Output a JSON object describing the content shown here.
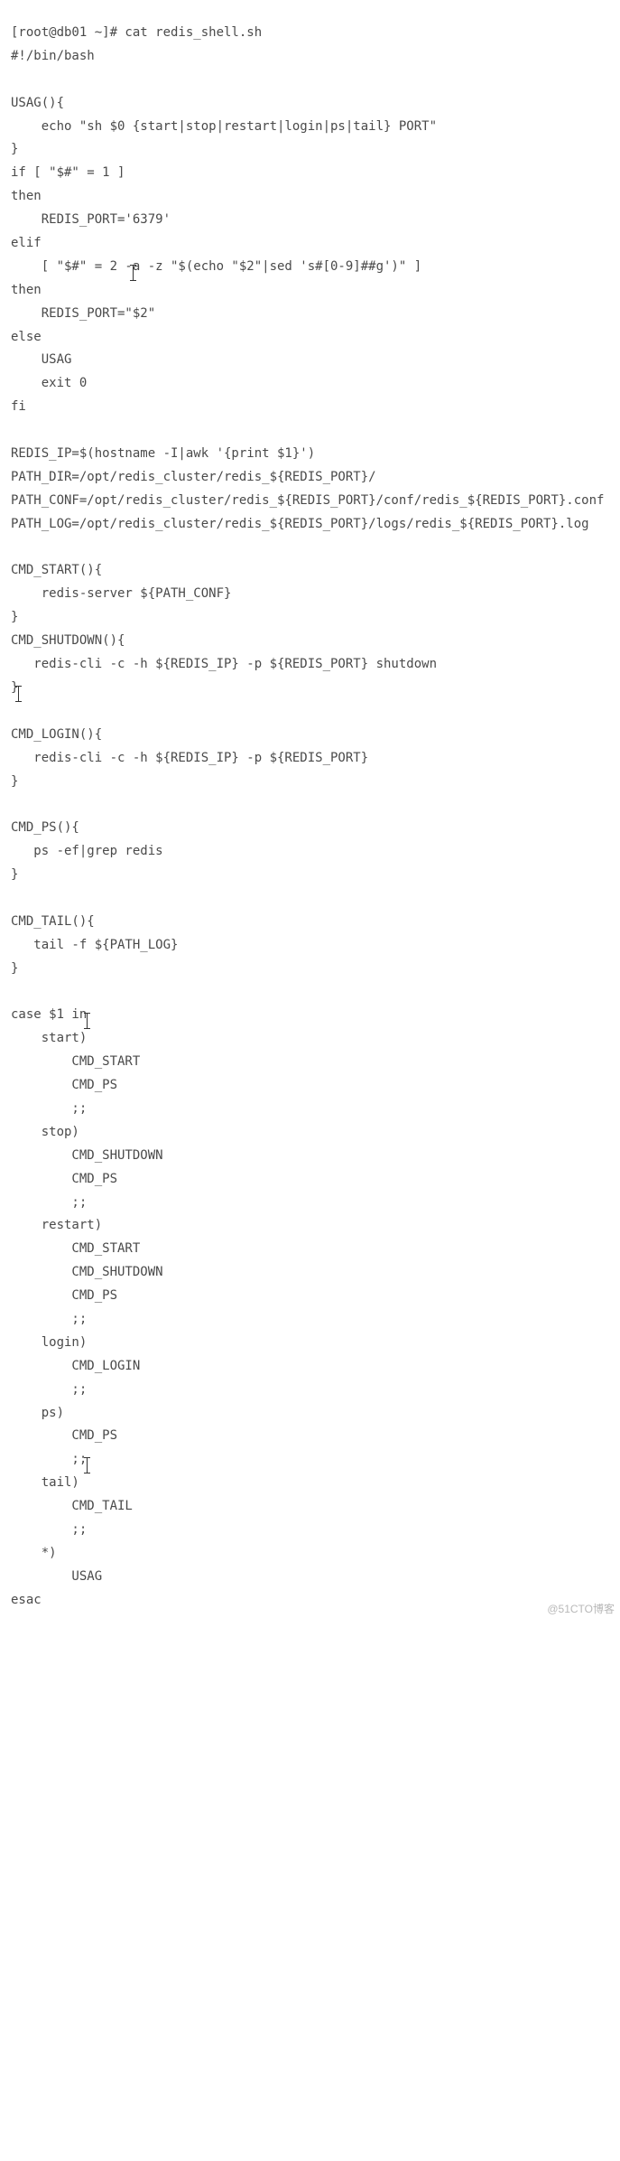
{
  "code": {
    "lines": [
      "[root@db01 ~]# cat redis_shell.sh",
      "#!/bin/bash",
      "",
      "USAG(){",
      "    echo \"sh $0 {start|stop|restart|login|ps|tail} PORT\"",
      "}",
      "if [ \"$#\" = 1 ]",
      "then",
      "    REDIS_PORT='6379'",
      "elif",
      "    [ \"$#\" = 2 -a -z \"$(echo \"$2\"|sed 's#[0-9]##g')\" ]",
      "then",
      "    REDIS_PORT=\"$2\"",
      "else",
      "    USAG",
      "    exit 0",
      "fi",
      "",
      "REDIS_IP=$(hostname -I|awk '{print $1}')",
      "PATH_DIR=/opt/redis_cluster/redis_${REDIS_PORT}/",
      "PATH_CONF=/opt/redis_cluster/redis_${REDIS_PORT}/conf/redis_${REDIS_PORT}.conf",
      "PATH_LOG=/opt/redis_cluster/redis_${REDIS_PORT}/logs/redis_${REDIS_PORT}.log",
      "",
      "CMD_START(){",
      "    redis-server ${PATH_CONF}",
      "}",
      "CMD_SHUTDOWN(){",
      "   redis-cli -c -h ${REDIS_IP} -p ${REDIS_PORT} shutdown",
      "}",
      "",
      "CMD_LOGIN(){",
      "   redis-cli -c -h ${REDIS_IP} -p ${REDIS_PORT}",
      "}",
      "",
      "CMD_PS(){",
      "   ps -ef|grep redis",
      "}",
      "",
      "CMD_TAIL(){",
      "   tail -f ${PATH_LOG}",
      "}",
      "",
      "case $1 in",
      "    start)",
      "        CMD_START",
      "        CMD_PS",
      "        ;;",
      "    stop)",
      "        CMD_SHUTDOWN",
      "        CMD_PS",
      "        ;;",
      "    restart)",
      "        CMD_START",
      "        CMD_SHUTDOWN",
      "        CMD_PS",
      "        ;;",
      "    login)",
      "        CMD_LOGIN",
      "        ;;",
      "    ps)",
      "        CMD_PS",
      "        ;;",
      "    tail)",
      "        CMD_TAIL",
      "        ;;",
      "    *)",
      "        USAG",
      "esac"
    ]
  },
  "watermark": "@51CTO博客",
  "cursors": [
    {
      "line": 10,
      "col": 16
    },
    {
      "line": 28,
      "col": 21
    },
    {
      "line": 42,
      "col": 20
    },
    {
      "line": 61,
      "col": 20
    }
  ]
}
